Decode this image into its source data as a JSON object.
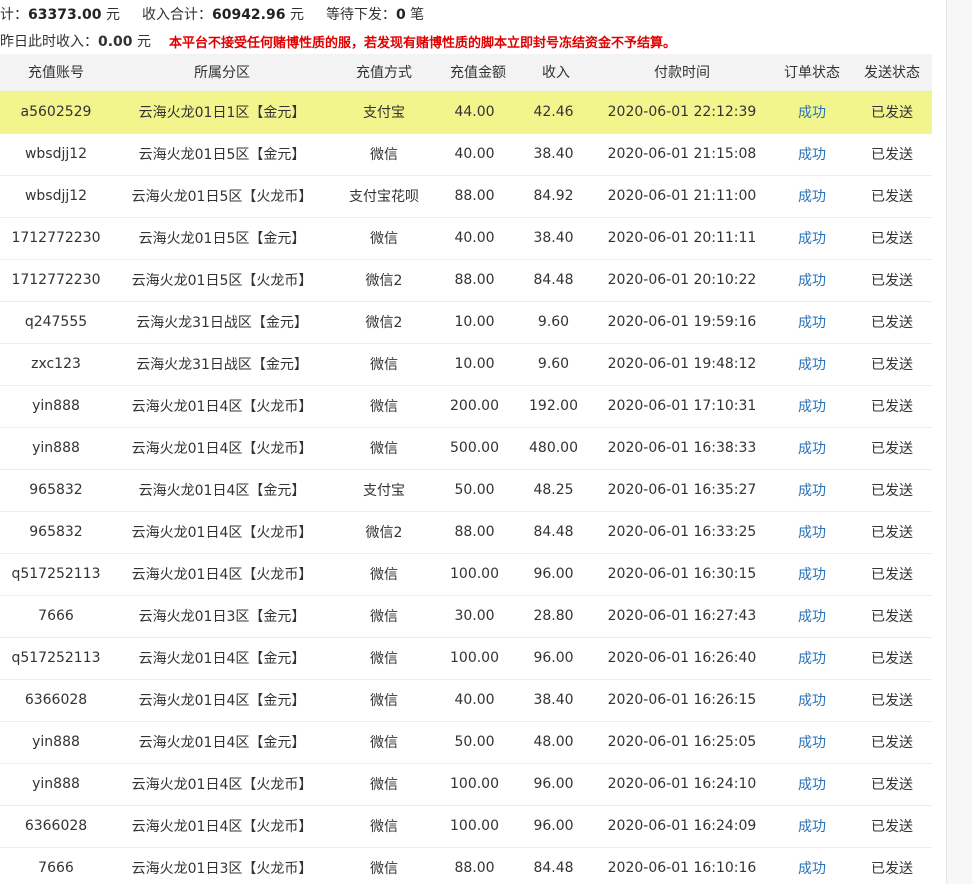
{
  "summary": {
    "total_label": "计：",
    "total_value": "63373.00",
    "total_unit": "元",
    "income_label": "收入合计：",
    "income_value": "60942.96",
    "income_unit": "元",
    "pending_label": "等待下发：",
    "pending_value": "0",
    "pending_unit": "笔",
    "yesterday_label": "昨日此时收入：",
    "yesterday_value": "0.00",
    "yesterday_unit": "元",
    "notice": "本平台不接受任何赌博性质的服，若发现有赌博性质的脚本立即封号冻结资金不予结算。"
  },
  "table": {
    "headers": [
      "充值账号",
      "所属分区",
      "充值方式",
      "充值金额",
      "收入",
      "付款时间",
      "订单状态",
      "发送状态"
    ],
    "rows": [
      {
        "account": "a5602529",
        "zone": "云海火龙01日1区【金元】",
        "method": "支付宝",
        "amount": "44.00",
        "income": "42.46",
        "time": "2020-06-01 22:12:39",
        "status": "成功",
        "send": "已发送",
        "highlight": true
      },
      {
        "account": "wbsdjj12",
        "zone": "云海火龙01日5区【金元】",
        "method": "微信",
        "amount": "40.00",
        "income": "38.40",
        "time": "2020-06-01 21:15:08",
        "status": "成功",
        "send": "已发送"
      },
      {
        "account": "wbsdjj12",
        "zone": "云海火龙01日5区【火龙币】",
        "method": "支付宝花呗",
        "amount": "88.00",
        "income": "84.92",
        "time": "2020-06-01 21:11:00",
        "status": "成功",
        "send": "已发送"
      },
      {
        "account": "1712772230",
        "zone": "云海火龙01日5区【金元】",
        "method": "微信",
        "amount": "40.00",
        "income": "38.40",
        "time": "2020-06-01 20:11:11",
        "status": "成功",
        "send": "已发送"
      },
      {
        "account": "1712772230",
        "zone": "云海火龙01日5区【火龙币】",
        "method": "微信2",
        "amount": "88.00",
        "income": "84.48",
        "time": "2020-06-01 20:10:22",
        "status": "成功",
        "send": "已发送"
      },
      {
        "account": "q247555",
        "zone": "云海火龙31日战区【金元】",
        "method": "微信2",
        "amount": "10.00",
        "income": "9.60",
        "time": "2020-06-01 19:59:16",
        "status": "成功",
        "send": "已发送"
      },
      {
        "account": "zxc123",
        "zone": "云海火龙31日战区【金元】",
        "method": "微信",
        "amount": "10.00",
        "income": "9.60",
        "time": "2020-06-01 19:48:12",
        "status": "成功",
        "send": "已发送"
      },
      {
        "account": "yin888",
        "zone": "云海火龙01日4区【火龙币】",
        "method": "微信",
        "amount": "200.00",
        "income": "192.00",
        "time": "2020-06-01 17:10:31",
        "status": "成功",
        "send": "已发送"
      },
      {
        "account": "yin888",
        "zone": "云海火龙01日4区【火龙币】",
        "method": "微信",
        "amount": "500.00",
        "income": "480.00",
        "time": "2020-06-01 16:38:33",
        "status": "成功",
        "send": "已发送"
      },
      {
        "account": "965832",
        "zone": "云海火龙01日4区【金元】",
        "method": "支付宝",
        "amount": "50.00",
        "income": "48.25",
        "time": "2020-06-01 16:35:27",
        "status": "成功",
        "send": "已发送"
      },
      {
        "account": "965832",
        "zone": "云海火龙01日4区【火龙币】",
        "method": "微信2",
        "amount": "88.00",
        "income": "84.48",
        "time": "2020-06-01 16:33:25",
        "status": "成功",
        "send": "已发送"
      },
      {
        "account": "q517252113",
        "zone": "云海火龙01日4区【火龙币】",
        "method": "微信",
        "amount": "100.00",
        "income": "96.00",
        "time": "2020-06-01 16:30:15",
        "status": "成功",
        "send": "已发送"
      },
      {
        "account": "7666",
        "zone": "云海火龙01日3区【金元】",
        "method": "微信",
        "amount": "30.00",
        "income": "28.80",
        "time": "2020-06-01 16:27:43",
        "status": "成功",
        "send": "已发送"
      },
      {
        "account": "q517252113",
        "zone": "云海火龙01日4区【金元】",
        "method": "微信",
        "amount": "100.00",
        "income": "96.00",
        "time": "2020-06-01 16:26:40",
        "status": "成功",
        "send": "已发送"
      },
      {
        "account": "6366028",
        "zone": "云海火龙01日4区【金元】",
        "method": "微信",
        "amount": "40.00",
        "income": "38.40",
        "time": "2020-06-01 16:26:15",
        "status": "成功",
        "send": "已发送"
      },
      {
        "account": "yin888",
        "zone": "云海火龙01日4区【金元】",
        "method": "微信",
        "amount": "50.00",
        "income": "48.00",
        "time": "2020-06-01 16:25:05",
        "status": "成功",
        "send": "已发送"
      },
      {
        "account": "yin888",
        "zone": "云海火龙01日4区【火龙币】",
        "method": "微信",
        "amount": "100.00",
        "income": "96.00",
        "time": "2020-06-01 16:24:10",
        "status": "成功",
        "send": "已发送"
      },
      {
        "account": "6366028",
        "zone": "云海火龙01日4区【火龙币】",
        "method": "微信",
        "amount": "100.00",
        "income": "96.00",
        "time": "2020-06-01 16:24:09",
        "status": "成功",
        "send": "已发送"
      },
      {
        "account": "7666",
        "zone": "云海火龙01日3区【火龙币】",
        "method": "微信",
        "amount": "88.00",
        "income": "84.48",
        "time": "2020-06-01 16:10:16",
        "status": "成功",
        "send": "已发送"
      }
    ]
  },
  "colors": {
    "highlight_row": "#f2f58c",
    "status_link": "#2a72b8",
    "notice_red": "#e00000",
    "header_bg": "#f3f3f3"
  }
}
